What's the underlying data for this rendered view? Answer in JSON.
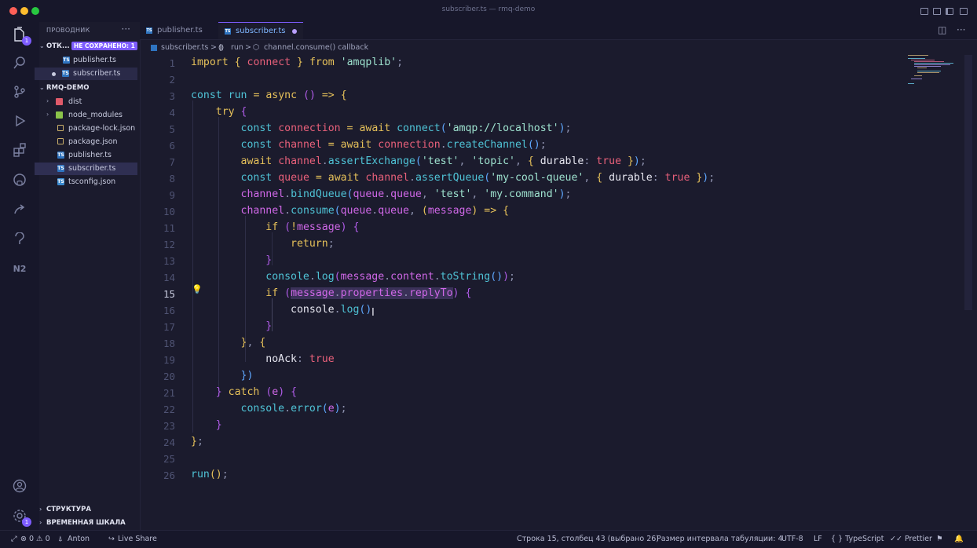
{
  "window": {
    "title": "subscriber.ts — rmq-demo"
  },
  "activity_bar": {
    "explorer_badge": "1",
    "settings_badge": "1"
  },
  "sidebar": {
    "title": "ПРОВОДНИК",
    "more": "···",
    "open_editors": {
      "label": "ОТК...",
      "unsaved_badge": "НЕ СОХРАНЕНО: 1",
      "files": [
        "publisher.ts",
        "subscriber.ts"
      ]
    },
    "project": {
      "label": "RMQ-DEMO",
      "items": [
        {
          "name": "dist",
          "kind": "folder-dist"
        },
        {
          "name": "node_modules",
          "kind": "folder-node"
        },
        {
          "name": "package-lock.json",
          "kind": "json"
        },
        {
          "name": "package.json",
          "kind": "json"
        },
        {
          "name": "publisher.ts",
          "kind": "ts"
        },
        {
          "name": "subscriber.ts",
          "kind": "ts"
        },
        {
          "name": "tsconfig.json",
          "kind": "tsconfig"
        }
      ]
    },
    "outline_label": "СТРУКТУРА",
    "timeline_label": "ВРЕМЕННАЯ ШКАЛА"
  },
  "tabs": [
    {
      "label": "publisher.ts",
      "icon": "TS"
    },
    {
      "label": "subscriber.ts",
      "icon": "TS"
    }
  ],
  "breadcrumb": {
    "file": "subscriber.ts",
    "sep": ">",
    "fn": "run",
    "callback": "channel.consume() callback"
  },
  "editor": {
    "line_numbers": [
      "1",
      "2",
      "3",
      "4",
      "5",
      "6",
      "7",
      "8",
      "9",
      "10",
      "11",
      "12",
      "13",
      "14",
      "15",
      "16",
      "17",
      "18",
      "19",
      "20",
      "21",
      "22",
      "23",
      "24",
      "25",
      "26"
    ],
    "tokens": {
      "import": "import",
      "connect": "connect",
      "from": "from",
      "amqplib": "'amqplib'",
      "const": "const",
      "run": "run",
      "async": "async",
      "try": "try",
      "connection": "connection",
      "await": "await",
      "amqp_url": "'amqp://localhost'",
      "channel": "channel",
      "createChannel": "createChannel",
      "assertExchange": "assertExchange",
      "test": "'test'",
      "topic": "'topic'",
      "durable": "durable",
      "true": "true",
      "queue": "queue",
      "assertQueue": "assertQueue",
      "my_cool_queue": "'my-cool-queue'",
      "bindQueue": "bindQueue",
      "my_command": "'my.command'",
      "consume": "consume",
      "message": "message",
      "if": "if",
      "return": "return",
      "console": "console",
      "log": "log",
      "content": "content",
      "toString": "toString",
      "properties": "properties",
      "replyTo": "replyTo",
      "noAck": "noAck",
      "catch": "catch",
      "e": "e",
      "error": "error"
    }
  },
  "status_bar": {
    "problems": "⊗ 0 ⚠ 0",
    "user": "Anton",
    "live_share": "Live Share",
    "position": "Строка 15, столбец 43 (выбрано 26)",
    "tab_size": "Размер интервала табуляции: 4",
    "encoding": "UTF-8",
    "eol": "LF",
    "language": "{ } TypeScript",
    "prettier": "✓✓ Prettier"
  },
  "colors": {
    "accent": "#7d5cff",
    "background": "#1b1b2d",
    "keyword": "#e6c15a",
    "function": "#4fc3d6",
    "string": "#9ee2cf",
    "variable": "#e8607a"
  }
}
